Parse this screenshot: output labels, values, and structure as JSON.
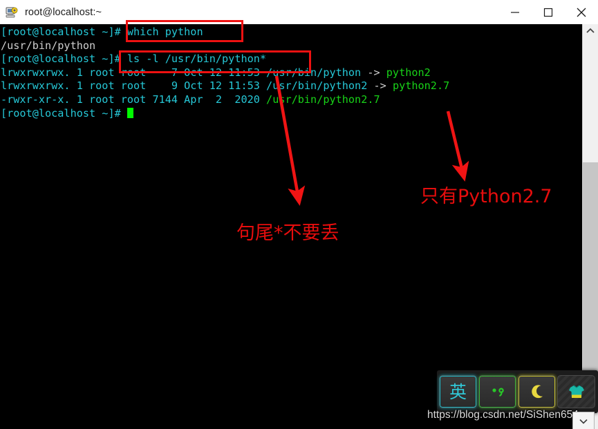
{
  "window": {
    "title": "root@localhost:~",
    "icon": "putty-terminal-icon",
    "controls": {
      "minimize_label": "Minimize",
      "maximize_label": "Maximize",
      "close_label": "Close"
    }
  },
  "terminal": {
    "prompt": "[root@localhost ~]#",
    "lines": [
      {
        "id": "line-cmd-which",
        "segments": [
          {
            "text": "[root@localhost ~]# ",
            "color": "cyan"
          },
          {
            "text": "which python",
            "color": "cyan"
          }
        ]
      },
      {
        "id": "line-out-which",
        "segments": [
          {
            "text": "/usr/bin/python",
            "color": "white"
          }
        ]
      },
      {
        "id": "line-cmd-ls",
        "segments": [
          {
            "text": "[root@localhost ~]# ",
            "color": "cyan"
          },
          {
            "text": "ls -l /usr/bin/python*",
            "color": "cyan"
          }
        ]
      },
      {
        "id": "line-ls-python",
        "segments": [
          {
            "text": "lrwxrwxrwx. 1 root root    7 Oct 12 11:53 ",
            "color": "cyan"
          },
          {
            "text": "/usr/bin/python",
            "color": "cyan"
          },
          {
            "text": " -> ",
            "color": "white"
          },
          {
            "text": "python2",
            "color": "green"
          }
        ]
      },
      {
        "id": "line-ls-python2",
        "segments": [
          {
            "text": "lrwxrwxrwx. 1 root root    9 Oct 12 11:53 ",
            "color": "cyan"
          },
          {
            "text": "/usr/bin/python2",
            "color": "cyan"
          },
          {
            "text": " -> ",
            "color": "white"
          },
          {
            "text": "python2.7",
            "color": "green"
          }
        ]
      },
      {
        "id": "line-ls-python27",
        "segments": [
          {
            "text": "-rwxr-xr-x. 1 root root 7144 Apr  2  2020 ",
            "color": "cyan"
          },
          {
            "text": "/usr/bin/python2.7",
            "color": "green"
          }
        ]
      },
      {
        "id": "line-prompt-active",
        "segments": [
          {
            "text": "[root@localhost ~]# ",
            "color": "cyan"
          }
        ],
        "cursor": true
      }
    ]
  },
  "annotations": {
    "accent_color": "#ee1111",
    "boxes": [
      {
        "id": "redbox-which",
        "target": "which python command"
      },
      {
        "id": "redbox-ls",
        "target": "ls -l /usr/bin/python* command"
      }
    ],
    "notes": [
      {
        "id": "annot-tail",
        "text": "句尾*不要丢"
      },
      {
        "id": "annot-only",
        "text": "只有Python2.7"
      }
    ]
  },
  "scrollbar": {
    "up_arrow": "chevron-up-icon",
    "down_arrow": "chevron-down-icon"
  },
  "ime_bar": {
    "keys": [
      {
        "id": "ime-language-key",
        "glyph": "英",
        "name": "language-mode-button"
      },
      {
        "id": "ime-punctuation-key",
        "glyph": "",
        "name": "punctuation-mode-button"
      },
      {
        "id": "ime-moon-key",
        "glyph": "",
        "name": "moon-mode-button"
      },
      {
        "id": "ime-skin-key",
        "glyph": "",
        "name": "skin-shirt-button"
      }
    ],
    "collapse_glyph": "⌄"
  },
  "watermark": {
    "text": "https://blog.csdn.net/SiShen654"
  }
}
